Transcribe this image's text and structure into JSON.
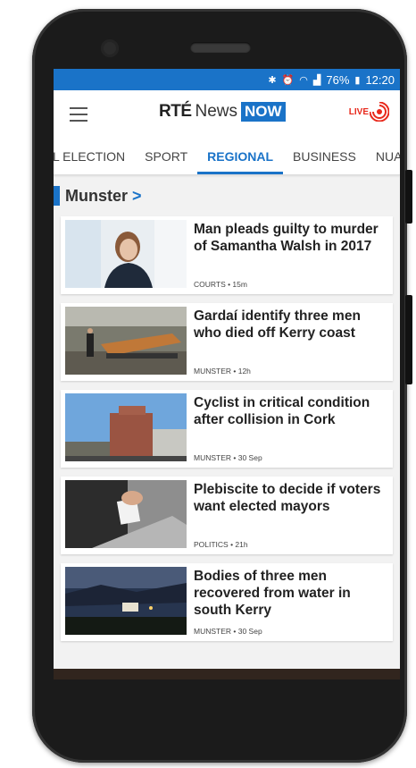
{
  "status_bar": {
    "battery": "76%",
    "time": "12:20"
  },
  "app_bar": {
    "logo_rte": "RTÉ",
    "logo_news": "News",
    "logo_now": "NOW",
    "live_label": "LIVE"
  },
  "tabs": [
    {
      "label": "L ELECTION"
    },
    {
      "label": "SPORT"
    },
    {
      "label": "REGIONAL"
    },
    {
      "label": "BUSINESS"
    },
    {
      "label": "NUACHT"
    }
  ],
  "section": {
    "title": "Munster",
    "arrow": ">"
  },
  "articles": [
    {
      "headline": "Man pleads guilty to murder of Samantha Walsh in 2017",
      "meta": "COURTS • 15m"
    },
    {
      "headline": "Gardaí identify three men who died off Kerry coast",
      "meta": "MUNSTER • 12h"
    },
    {
      "headline": "Cyclist in critical condition after collision in Cork",
      "meta": "MUNSTER • 30 Sep"
    },
    {
      "headline": "Plebiscite to decide if voters want elected mayors",
      "meta": "POLITICS • 21h"
    },
    {
      "headline": "Bodies of three men recovered from water in south Kerry",
      "meta": "MUNSTER • 30 Sep"
    }
  ],
  "colors": {
    "accent": "#1a73c8",
    "live_red": "#e8291c"
  }
}
